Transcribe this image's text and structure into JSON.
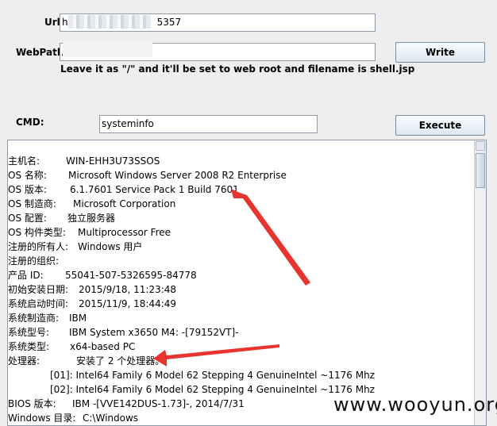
{
  "form": {
    "url_label": "Url:",
    "url_value_prefix": "h",
    "url_value_suffix": "5357",
    "webpath_label": "WebPath:",
    "webpath_value": "/",
    "write_button": "Write",
    "hint": "Leave it as \"/\" and it'll be set to web root and filename is shell.jsp",
    "cmd_label": "CMD:",
    "cmd_value": "systeminfo",
    "execute_button": "Execute"
  },
  "output": {
    "lines": [
      {
        "k": "主机名:",
        "v": "WIN-EHH3U73SSOS"
      },
      {
        "k": "OS 名称:",
        "v": "Microsoft Windows Server 2008 R2 Enterprise"
      },
      {
        "k": "OS 版本:",
        "v": "6.1.7601 Service Pack 1 Build 7601"
      },
      {
        "k": "OS 制造商:",
        "v": "Microsoft Corporation"
      },
      {
        "k": "OS 配置:",
        "v": "独立服务器"
      },
      {
        "k": "OS 构件类型:",
        "v": "Multiprocessor Free"
      },
      {
        "k": "注册的所有人:",
        "v": "Windows 用户"
      },
      {
        "k": "注册的组织:",
        "v": ""
      },
      {
        "k": "产品 ID:",
        "v": "55041-507-5326595-84778"
      },
      {
        "k": "初始安装日期:",
        "v": "2015/9/18, 11:23:48"
      },
      {
        "k": "系统启动时间:",
        "v": "2015/11/9, 18:44:49"
      },
      {
        "k": "系统制造商:",
        "v": "IBM"
      },
      {
        "k": "系统型号:",
        "v": "IBM System x3650 M4: -[79152VT]-"
      },
      {
        "k": "系统类型:",
        "v": "x64-based PC"
      },
      {
        "k": "处理器:",
        "v": "安装了 2 个处理器。"
      },
      {
        "k": "",
        "v": "[01]: Intel64 Family 6 Model 62 Stepping 4 GenuineIntel ~1176 Mhz"
      },
      {
        "k": "",
        "v": "[02]: Intel64 Family 6 Model 62 Stepping 4 GenuineIntel ~1176 Mhz"
      },
      {
        "k": "BIOS 版本:",
        "v": "IBM -[VVE142DUS-1.73]-, 2014/7/31"
      },
      {
        "k": "Windows 目录:",
        "v": "C:\\Windows"
      }
    ]
  },
  "watermark": "www.wooyun.org",
  "colors": {
    "arrow": "#e8342f"
  }
}
